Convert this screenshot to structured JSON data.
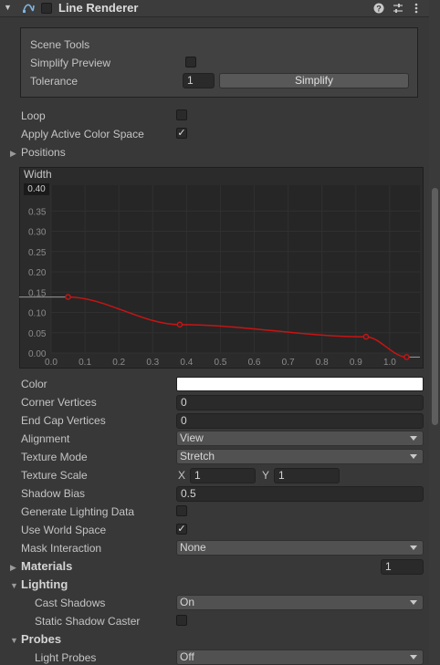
{
  "header": {
    "title": "Line Renderer",
    "enabled": false
  },
  "scene_tools": {
    "title": "Scene Tools",
    "simplify_preview_label": "Simplify Preview",
    "simplify_preview_checked": false,
    "tolerance_label": "Tolerance",
    "tolerance_value": "1",
    "simplify_button": "Simplify"
  },
  "loop": {
    "label": "Loop",
    "checked": false
  },
  "apply_active_color_space": {
    "label": "Apply Active Color Space",
    "checked": true,
    "check_glyph": "✓"
  },
  "positions_label": "Positions",
  "width_curve": {
    "title": "Width",
    "max_value_label": "0.40",
    "chart_data": {
      "type": "line",
      "title": "Width",
      "xlabel": "",
      "ylabel": "",
      "xlim": [
        0.0,
        1.1
      ],
      "ylim": [
        0.0,
        0.4
      ],
      "x_ticks": [
        "0.0",
        "0.1",
        "0.2",
        "0.3",
        "0.4",
        "0.5",
        "0.6",
        "0.7",
        "0.8",
        "0.9",
        "1.0"
      ],
      "y_ticks": [
        "0.35",
        "0.30",
        "0.25",
        "0.20",
        "0.15",
        "0.10",
        "0.05",
        "0.00"
      ],
      "keys": [
        {
          "x": 0.05,
          "y": 0.138
        },
        {
          "x": 0.38,
          "y": 0.07
        },
        {
          "x": 0.93,
          "y": 0.04
        },
        {
          "x": 1.05,
          "y": -0.01
        }
      ],
      "curve_color": "#c81414"
    }
  },
  "properties": {
    "color_label": "Color",
    "color_value": "#ffffff",
    "corner_vertices_label": "Corner Vertices",
    "corner_vertices_value": "0",
    "end_cap_vertices_label": "End Cap Vertices",
    "end_cap_vertices_value": "0",
    "alignment_label": "Alignment",
    "alignment_value": "View",
    "texture_mode_label": "Texture Mode",
    "texture_mode_value": "Stretch",
    "texture_scale_label": "Texture Scale",
    "texture_scale_x_label": "X",
    "texture_scale_x": "1",
    "texture_scale_y_label": "Y",
    "texture_scale_y": "1",
    "shadow_bias_label": "Shadow Bias",
    "shadow_bias_value": "0.5",
    "generate_lighting_label": "Generate Lighting Data",
    "use_world_space_label": "Use World Space",
    "use_world_space_glyph": "✓",
    "mask_interaction_label": "Mask Interaction",
    "mask_interaction_value": "None"
  },
  "materials": {
    "label": "Materials",
    "count": "1"
  },
  "lighting": {
    "label": "Lighting",
    "cast_shadows_label": "Cast Shadows",
    "cast_shadows_value": "On",
    "static_shadow_label": "Static Shadow Caster"
  },
  "probes": {
    "label": "Probes",
    "light_probes_label": "Light Probes",
    "light_probes_value": "Off"
  },
  "icons": {
    "help": "question-icon",
    "presets": "sliders-icon",
    "menu": "kebab-icon"
  }
}
